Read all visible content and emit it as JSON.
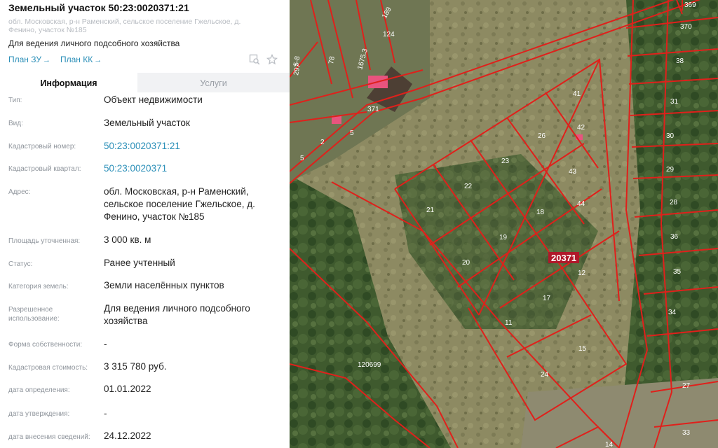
{
  "panel": {
    "title": "Земельный участок 50:23:0020371:21",
    "subaddress": "обл. Московская, р-н Раменский, сельское поселение Гжельское, д. Фенино, участок №185",
    "purpose": "Для ведения личного подсобного хозяйства",
    "plan_zu": "План ЗУ",
    "plan_kk": "План КК",
    "arrow": "→",
    "tabs": {
      "info": "Информация",
      "services": "Услуги"
    },
    "rows": [
      {
        "label": "Тип:",
        "value": "Объект недвижимости"
      },
      {
        "label": "Вид:",
        "value": "Земельный участок"
      },
      {
        "label": "Кадастровый номер:",
        "value": "50:23:0020371:21"
      },
      {
        "label": "Кадастровый квартал:",
        "value": "50:23:0020371"
      },
      {
        "label": "Адрес:",
        "value": "обл. Московская, р-н Раменский, сельское поселение Гжельское, д. Фенино, участок №185"
      },
      {
        "label": "Площадь уточненная:",
        "value": "3 000 кв. м"
      },
      {
        "label": "Статус:",
        "value": "Ранее учтенный"
      },
      {
        "label": "Категория земель:",
        "value": "Земли населённых пунктов"
      },
      {
        "label": "Разрешенное использование:",
        "value": "Для ведения личного подсобного хозяйства"
      },
      {
        "label": "Форма собственности:",
        "value": "-"
      },
      {
        "label": "Кадастровая стоимость:",
        "value": "3 315 780 руб."
      },
      {
        "label": "дата определения:",
        "value": "01.01.2022"
      },
      {
        "label": "дата утверждения:",
        "value": "-"
      },
      {
        "label": "дата внесения сведений:",
        "value": "24.12.2022"
      }
    ]
  },
  "icons": {
    "map_search": "map-search-icon",
    "favorite": "star-icon"
  },
  "colors": {
    "link": "#2b8fb8",
    "parcel_border": "#e0201b",
    "label_gray": "#8f959c"
  },
  "map": {
    "quarter_label": "20371",
    "road_label": "120699",
    "parcels": [
      "41",
      "42",
      "26",
      "23",
      "43",
      "22",
      "18",
      "44",
      "21",
      "19",
      "20",
      "12",
      "17",
      "11",
      "15",
      "24",
      "369",
      "370",
      "38",
      "31",
      "30",
      "29",
      "28",
      "36",
      "35",
      "34",
      "27",
      "33",
      "14",
      "189",
      "124",
      "1675.3",
      "5-8",
      "78",
      "297",
      "371",
      "2",
      "5",
      "5"
    ]
  }
}
